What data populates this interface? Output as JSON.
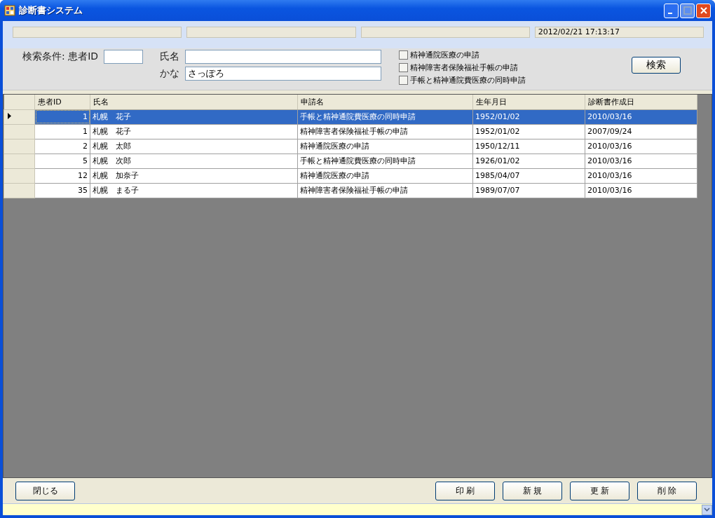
{
  "window": {
    "title": "診断書システム"
  },
  "status_bar": {
    "datetime": "2012/02/21 17:13:17"
  },
  "search": {
    "condition_label": "検索条件: 患者ID",
    "name_label": "氏名",
    "kana_label": "かな",
    "kana_value": "さっぽろ",
    "button": "検索",
    "checkboxes": [
      {
        "label": "精神通院医療の申請",
        "checked": false
      },
      {
        "label": "精神障害者保険福祉手帳の申請",
        "checked": false
      },
      {
        "label": "手帳と精神通院費医療の同時申請",
        "checked": false
      }
    ]
  },
  "table": {
    "columns": [
      "患者ID",
      "氏名",
      "申請名",
      "生年月日",
      "診断書作成日"
    ],
    "rows": [
      {
        "selected": true,
        "cells": [
          "1",
          "札幌　花子",
          "手帳と精神通院費医療の同時申請",
          "1952/01/02",
          "2010/03/16"
        ]
      },
      {
        "selected": false,
        "cells": [
          "1",
          "札幌　花子",
          "精神障害者保険福祉手帳の申請",
          "1952/01/02",
          "2007/09/24"
        ]
      },
      {
        "selected": false,
        "cells": [
          "2",
          "札幌　太郎",
          "精神通院医療の申請",
          "1950/12/11",
          "2010/03/16"
        ]
      },
      {
        "selected": false,
        "cells": [
          "5",
          "札幌　次郎",
          "手帳と精神通院費医療の同時申請",
          "1926/01/02",
          "2010/03/16"
        ]
      },
      {
        "selected": false,
        "cells": [
          "12",
          "札幌　加奈子",
          "精神通院医療の申請",
          "1985/04/07",
          "2010/03/16"
        ]
      },
      {
        "selected": false,
        "cells": [
          "35",
          "札幌　まる子",
          "精神障害者保険福祉手帳の申請",
          "1989/07/07",
          "2010/03/16"
        ]
      }
    ]
  },
  "buttons_left": [
    "閉じる"
  ],
  "buttons_right": [
    "印 刷",
    "新 規",
    "更 新",
    "削 除"
  ]
}
